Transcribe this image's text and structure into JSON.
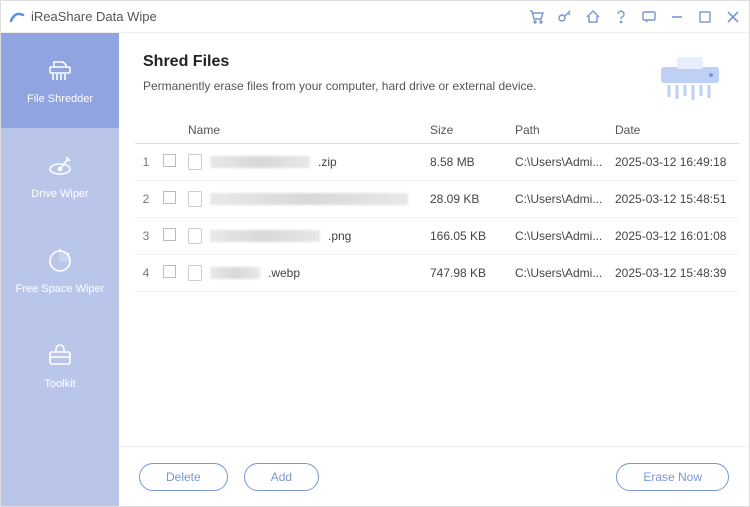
{
  "app": {
    "title": "iReaShare Data Wipe"
  },
  "sidebar": {
    "items": [
      {
        "label": "File Shredder"
      },
      {
        "label": "Drive Wiper"
      },
      {
        "label": "Free Space Wiper"
      },
      {
        "label": "Toolkit"
      }
    ]
  },
  "page": {
    "title": "Shred Files",
    "subtitle": "Permanently erase files from your computer, hard drive or external device."
  },
  "table": {
    "columns": {
      "name": "Name",
      "size": "Size",
      "path": "Path",
      "date": "Date"
    },
    "rows": [
      {
        "idx": "1",
        "ext": ".zip",
        "size": "8.58 MB",
        "path": "C:\\Users\\Admi...",
        "date": "2025-03-12 16:49:18",
        "redact_w": 100
      },
      {
        "idx": "2",
        "ext": "",
        "size": "28.09 KB",
        "path": "C:\\Users\\Admi...",
        "date": "2025-03-12 15:48:51",
        "redact_w": 198
      },
      {
        "idx": "3",
        "ext": ".png",
        "size": "166.05 KB",
        "path": "C:\\Users\\Admi...",
        "date": "2025-03-12 16:01:08",
        "redact_w": 110
      },
      {
        "idx": "4",
        "ext": ".webp",
        "size": "747.98 KB",
        "path": "C:\\Users\\Admi...",
        "date": "2025-03-12 15:48:39",
        "redact_w": 50
      }
    ]
  },
  "footer": {
    "delete_label": "Delete",
    "add_label": "Add",
    "erase_label": "Erase Now"
  }
}
